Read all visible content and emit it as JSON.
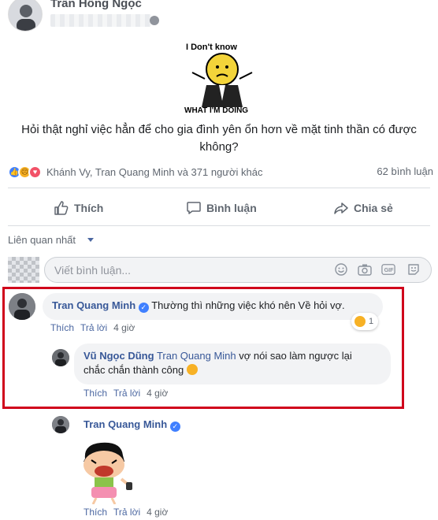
{
  "post": {
    "author_name": "Trần Hồng Ngọc",
    "sticker_caption_top": "I Don't know",
    "sticker_caption_bottom": "WHAT I'M DOING",
    "text": "Hỏi thật nghỉ việc hẳn để cho gia đình yên ổn hơn về mặt tinh thần có được không?",
    "reactions_text": "Khánh Vy, Tran Quang Minh và 371 người khác",
    "comment_count": "62 bình luận"
  },
  "actions": {
    "like": "Thích",
    "comment": "Bình luận",
    "share": "Chia sẻ"
  },
  "sort": {
    "label": "Liên quan nhất"
  },
  "input": {
    "placeholder": "Viết bình luận..."
  },
  "comments": [
    {
      "name": "Tran Quang Minh",
      "text": "Thường thì những việc khó nên Về hỏi vợ.",
      "like": "Thích",
      "reply": "Trả lời",
      "time": "4 giờ",
      "reaction_count": "1"
    },
    {
      "name": "Vũ Ngọc Dũng",
      "mention": "Tran Quang Minh",
      "text_line1": "vợ nói sao làm ngược lại",
      "text_line2": "chắc chắn thành công",
      "like": "Thích",
      "reply": "Trả lời",
      "time": "4 giờ"
    },
    {
      "name": "Tran Quang Minh",
      "like": "Thích",
      "reply": "Trả lời",
      "time": "4 giờ"
    }
  ],
  "colors": {
    "link": "#385898",
    "highlight": "#d0021b",
    "like_blue": "#4080ff"
  },
  "icons": [
    "privacy-globe-icon",
    "like-thumb-icon",
    "comment-bubble-icon",
    "share-arrow-icon",
    "emoji-icon",
    "camera-icon",
    "gif-icon",
    "sticker-icon",
    "verified-icon"
  ]
}
